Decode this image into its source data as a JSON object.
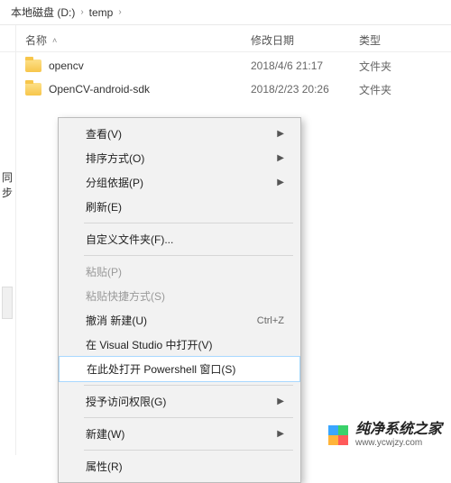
{
  "breadcrumb": {
    "root": "本地磁盘 (D:)",
    "path1": "temp"
  },
  "columns": {
    "name": "名称",
    "date": "修改日期",
    "type": "类型"
  },
  "rows": [
    {
      "name": "opencv",
      "date": "2018/4/6 21:17",
      "type": "文件夹"
    },
    {
      "name": "OpenCV-android-sdk",
      "date": "2018/2/23 20:26",
      "type": "文件夹"
    }
  ],
  "sidebar_fragment": "同步",
  "context_menu": {
    "view": "查看(V)",
    "sort": "排序方式(O)",
    "group": "分组依据(P)",
    "refresh": "刷新(E)",
    "customize": "自定义文件夹(F)...",
    "paste": "粘贴(P)",
    "paste_shortcut": "粘贴快捷方式(S)",
    "undo": "撤消 新建(U)",
    "undo_shortcut": "Ctrl+Z",
    "open_vs": "在 Visual Studio 中打开(V)",
    "open_ps": "在此处打开 Powershell 窗口(S)",
    "grant_access": "授予访问权限(G)",
    "new": "新建(W)",
    "properties": "属性(R)"
  },
  "watermark": {
    "title": "纯净系统之家",
    "url": "www.ycwjzy.com"
  }
}
